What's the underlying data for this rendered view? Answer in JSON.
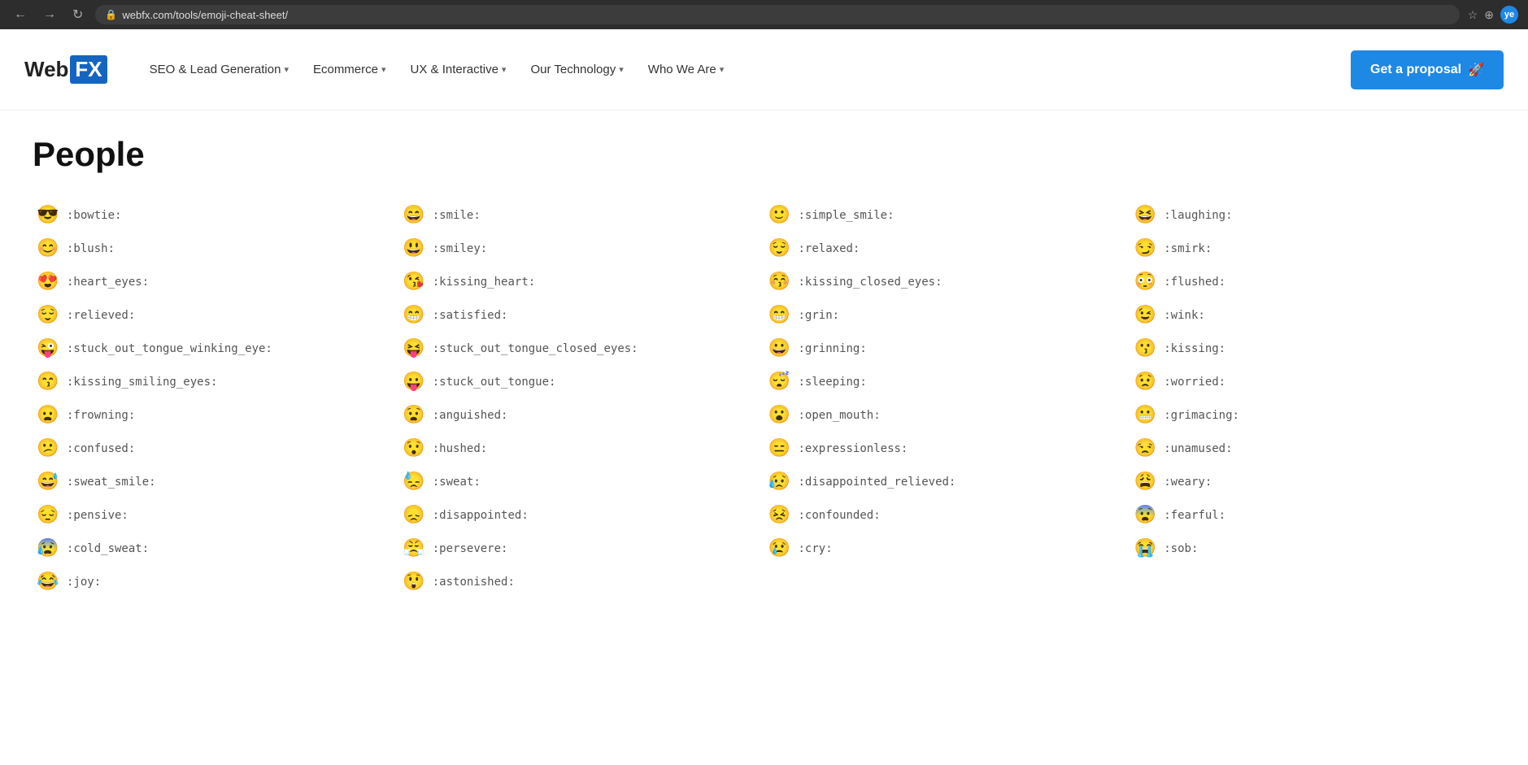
{
  "browser": {
    "url": "webfx.com/tools/emoji-cheat-sheet/",
    "back_label": "←",
    "forward_label": "→",
    "reload_label": "↻",
    "star_label": "★",
    "extension_label": "⊕",
    "avatar_label": "ye"
  },
  "header": {
    "logo_text": "Web",
    "logo_fx": "FX",
    "nav_items": [
      {
        "label": "SEO & Lead Generation",
        "has_dropdown": true
      },
      {
        "label": "Ecommerce",
        "has_dropdown": true
      },
      {
        "label": "UX & Interactive",
        "has_dropdown": true
      },
      {
        "label": "Our Technology",
        "has_dropdown": true
      },
      {
        "label": "Who We Are",
        "has_dropdown": true
      }
    ],
    "cta_label": "Get a proposal",
    "cta_icon": "🚀"
  },
  "page": {
    "heading": "People"
  },
  "emojis": [
    {
      "char": "😎",
      "code": ":bowtie:"
    },
    {
      "char": "😄",
      "code": ":smile:"
    },
    {
      "char": "🙂",
      "code": ":simple_smile:"
    },
    {
      "char": "😆",
      "code": ":laughing:"
    },
    {
      "char": "😊",
      "code": ":blush:"
    },
    {
      "char": "😃",
      "code": ":smiley:"
    },
    {
      "char": "😌",
      "code": ":relaxed:"
    },
    {
      "char": "😏",
      "code": ":smirk:"
    },
    {
      "char": "😍",
      "code": ":heart_eyes:"
    },
    {
      "char": "😘",
      "code": ":kissing_heart:"
    },
    {
      "char": "😚",
      "code": ":kissing_closed_eyes:"
    },
    {
      "char": "😳",
      "code": ":flushed:"
    },
    {
      "char": "😌",
      "code": ":relieved:"
    },
    {
      "char": "😁",
      "code": ":satisfied:"
    },
    {
      "char": "😁",
      "code": ":grin:"
    },
    {
      "char": "😉",
      "code": ":wink:"
    },
    {
      "char": "😜",
      "code": ":stuck_out_tongue_winking_eye:"
    },
    {
      "char": "😝",
      "code": ":stuck_out_tongue_closed_eyes:"
    },
    {
      "char": "😀",
      "code": ":grinning:"
    },
    {
      "char": "😗",
      "code": ":kissing:"
    },
    {
      "char": "😙",
      "code": ":kissing_smiling_eyes:"
    },
    {
      "char": "😛",
      "code": ":stuck_out_tongue:"
    },
    {
      "char": "😴",
      "code": ":sleeping:"
    },
    {
      "char": "😟",
      "code": ":worried:"
    },
    {
      "char": "😦",
      "code": ":frowning:"
    },
    {
      "char": "😧",
      "code": ":anguished:"
    },
    {
      "char": "😮",
      "code": ":open_mouth:"
    },
    {
      "char": "😬",
      "code": ":grimacing:"
    },
    {
      "char": "😕",
      "code": ":confused:"
    },
    {
      "char": "😯",
      "code": ":hushed:"
    },
    {
      "char": "😑",
      "code": ":expressionless:"
    },
    {
      "char": "😒",
      "code": ":unamused:"
    },
    {
      "char": "😅",
      "code": ":sweat_smile:"
    },
    {
      "char": "😓",
      "code": ":sweat:"
    },
    {
      "char": "😥",
      "code": ":disappointed_relieved:"
    },
    {
      "char": "😩",
      "code": ":weary:"
    },
    {
      "char": "😔",
      "code": ":pensive:"
    },
    {
      "char": "😞",
      "code": ":disappointed:"
    },
    {
      "char": "😣",
      "code": ":confounded:"
    },
    {
      "char": "😨",
      "code": ":fearful:"
    },
    {
      "char": "😰",
      "code": ":cold_sweat:"
    },
    {
      "char": "😤",
      "code": ":persevere:"
    },
    {
      "char": "😢",
      "code": ":cry:"
    },
    {
      "char": "😭",
      "code": ":sob:"
    },
    {
      "char": "😂",
      "code": ":joy:"
    },
    {
      "char": "😲",
      "code": ":astonished:"
    }
  ]
}
